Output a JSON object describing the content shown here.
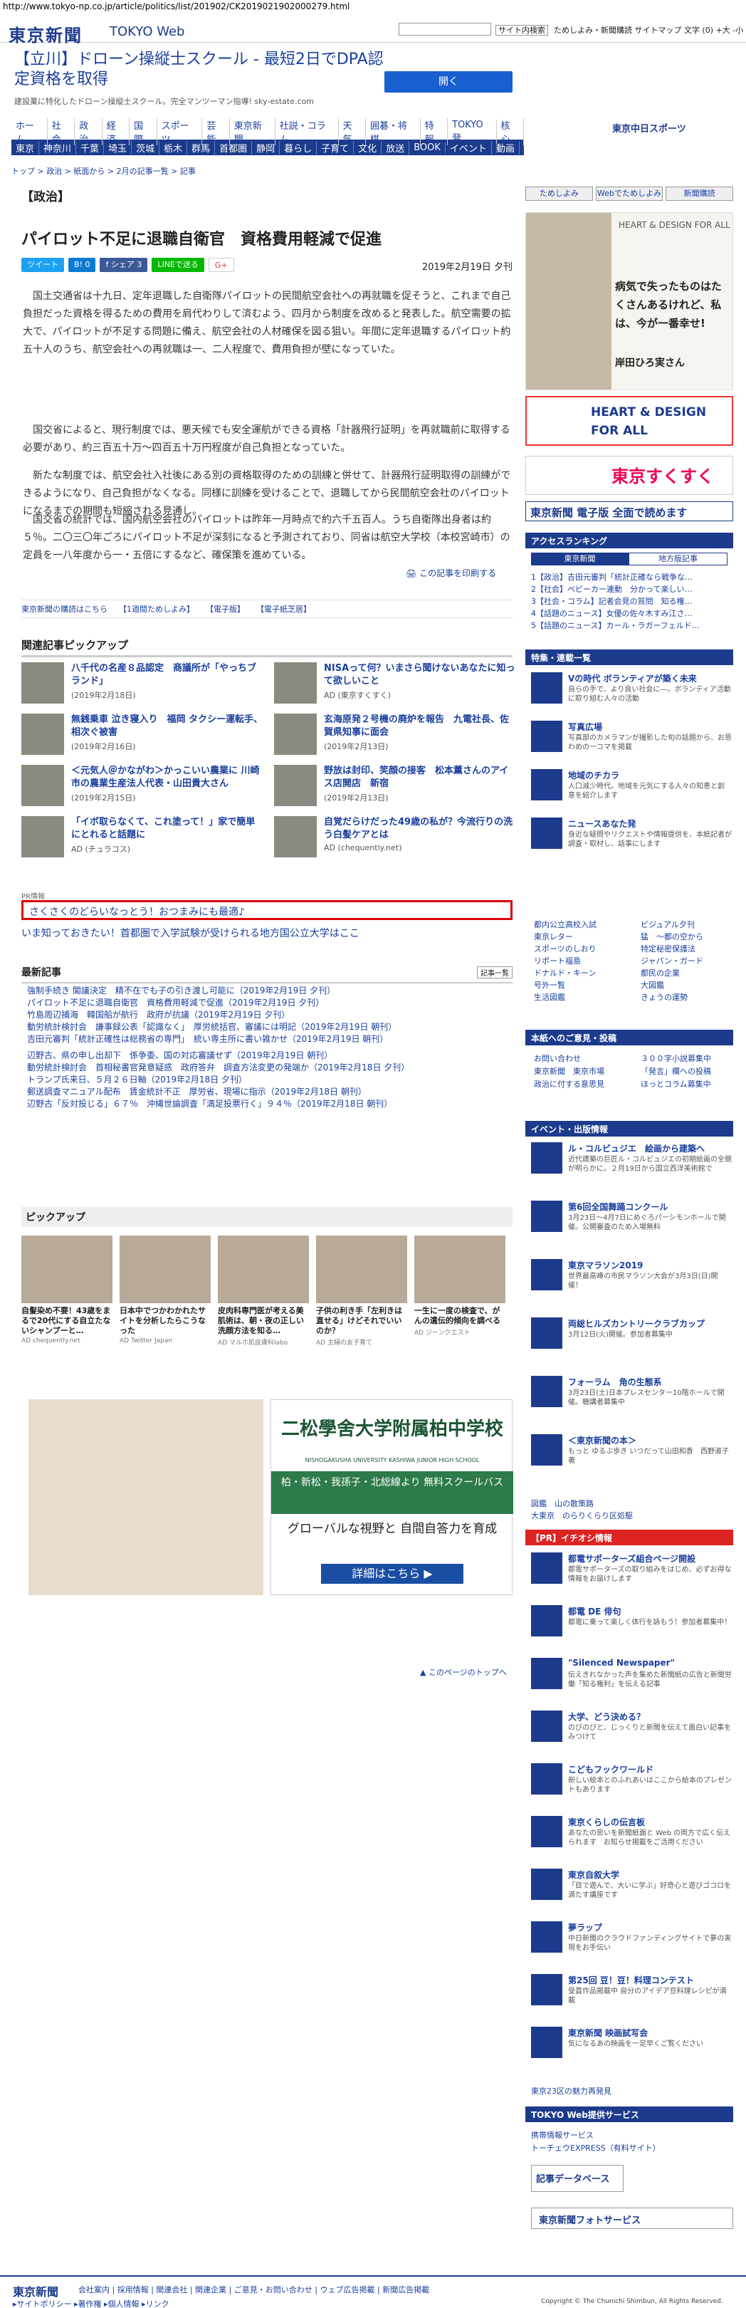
{
  "url": "http://www.tokyo-np.co.jp/article/politics/list/201902/CK2019021902000279.html",
  "header": {
    "logo": "東京新聞",
    "web": "TOKYO Web",
    "search_btn": "サイト内検索",
    "links": "ためしよみ・新聞購読  サイトマップ  文字 (0) +大 -小"
  },
  "ad": {
    "title": "【立川】ドローン操縦士スクール - 最短2日でDPA認定資格を取得",
    "sub": "建設業に特化したドローン操縦士スクール。完全マンツーマン指導! sky-estate.com",
    "button": "開く"
  },
  "nav": {
    "row1": [
      "ホーム",
      "社会",
      "政治",
      "経済",
      "国際",
      "スポーツ",
      "芸能",
      "東京新聞",
      "社説・コラム",
      "天気",
      "囲碁・将棋",
      "特報",
      "TOKYO発",
      "核心"
    ],
    "row2": [
      "東京",
      "神奈川",
      "千葉",
      "埼玉",
      "茨城",
      "栃木",
      "群馬",
      "首都圏",
      "静岡",
      "暮らし",
      "子育て",
      "文化",
      "放送",
      "BOOK",
      "イベント",
      "動画"
    ],
    "sports": "東京中日スポーツ"
  },
  "breadcrumb": "トップ > 政治 > 紙面から > 2月の記事一覧 > 記事",
  "article": {
    "genre": "【政治】",
    "title": "パイロット不足に退職自衛官　資格費用軽減で促進",
    "date": "2019年2月19日 夕刊",
    "share": [
      "ツイート",
      "B! 0",
      "f シェア 3",
      "LINEで送る",
      "G+"
    ],
    "paras": [
      "国土交通省は十九日、定年退職した自衛隊パイロットの民間航空会社への再就職を促そうと、これまで自己負担だった資格を得るための費用を肩代わりして済むよう、四月から制度を改めると発表した。航空需要の拡大で、パイロットが不足する問題に備え、航空会社の人材確保を図る狙い。年間に定年退職するパイロット約五十人のうち、航空会社への再就職は一、二人程度で、費用負担が壁になっていた。",
      "国交省によると、現行制度では、悪天候でも安全運航ができる資格「計器飛行証明」を再就職前に取得する必要があり、約三百五十万〜四百五十万円程度が自己負担となっていた。",
      "新たな制度では、航空会社入社後にある別の資格取得のための訓練と併せて、計器飛行証明取得の訓練ができるようになり、自己負担がなくなる。同様に訓練を受けることで、退職してから民間航空会社のパイロットになるまでの期間も短縮される見通し。",
      "国交省の統計では、国内航空会社のパイロットは昨年一月時点で約六千五百人。うち自衛隊出身者は約５％。二〇三〇年ごろにパイロット不足が深刻になると予測されており、同省は航空大学校（本校宮崎市）の定員を一八年度から一・五倍にするなど、確保策を進めている。"
    ],
    "print": "この記事を印刷する",
    "footer_links": [
      "東京新聞の購読はこちら",
      "【1週間ためしよみ】",
      "【電子版】",
      "【電子紙芝居】"
    ]
  },
  "related": {
    "heading": "関連記事ピックアップ",
    "items": [
      {
        "t": "八千代の名産８品認定　商議所が「やっちブランド」",
        "d": "(2019年2月18日)"
      },
      {
        "t": "NISAって何？いまさら聞けないあなたに知って欲しいこと",
        "d": "AD (東京すくすく)"
      },
      {
        "t": "無銭乗車 泣き寝入り　福岡 タクシー運転手、相次ぐ被害",
        "d": "(2019年2月16日)"
      },
      {
        "t": "玄海原発２号機の廃炉を報告　九電社長、佐賀県知事に面会",
        "d": "(2019年2月13日)"
      },
      {
        "t": "＜元気人＠かながわ＞かっこいい農業に 川崎市の農業生産法人代表・山田貴大さん",
        "d": "(2019年2月15日)"
      },
      {
        "t": "野放は封印、笑顔の接客　松本薫さんのアイス店開店　新宿",
        "d": "(2019年2月13日)"
      },
      {
        "t": "「イボ取らなくて、これ塗って！」家で簡単にとれると話題に",
        "d": "AD (チュラコス)"
      },
      {
        "t": "自覚だらけだった49歳の私が？今流行りの洗う白髪ケアとは",
        "d": "AD (chequently.net)"
      }
    ]
  },
  "pr": {
    "label": "PR情報",
    "box": "さくさくのどらいなっとう！おつまみにも最適♪",
    "line": "いま知っておきたい！首都圏で入学試験が受けられる地方国公立大学はここ"
  },
  "latest": {
    "heading": "最新記事",
    "ichiran": "記事一覧",
    "items": [
      "強制手続き 閣議決定　精不在でも子の引き渡し可能に（2019年2月19日 夕刊）",
      "パイロット不足に退職自衛官　資格費用軽減で促進（2019年2月19日 夕刊）",
      "竹島周辺捕海　韓国船が航行　政府が抗議（2019年2月19日 夕刊）",
      "動労統計検討会　謙事録公表「認識なく」　厚労統括官、審議には明記（2019年2月19日 朝刊）",
      "吉田元審判「統計正確性は総務省の専門」　統い専主所に書い雑かせ（2019年2月19日 朝刊）",
      "辺野古、県の申し出却下　係争委、国の対応審議せず（2019年2月19日 朝刊）",
      "動労統計検討会　首相秘書官発意疑惑　政府答弁　調査方法変更の発端か（2019年2月18日 夕刊）",
      "トランプ氏来日、５月２６日軸（2019年2月18日 夕刊）",
      "郵送調査マニュアル配布　賃金統計不正　厚労省、現場に指示（2019年2月18日 朝刊）",
      "辺野古「反対投じる」６７％　沖縄世論調査「満足投票行く」９４％（2019年2月18日 朝刊）"
    ]
  },
  "pickup": {
    "heading": "ピックアップ",
    "items": [
      {
        "t": "自髪染め不要！43歳をまるで20代にする自立たないシャンプーと…",
        "s": "AD chequently.net"
      },
      {
        "t": "日本中でつかわかれたサイトを分析したらこうなった",
        "s": "AD Twitter Japan"
      },
      {
        "t": "皮肉科専門医が考える美肌術は、朝・夜の正しい洗顔方法を知る…",
        "s": "AD マルホ肌皮膚科labo"
      },
      {
        "t": "子供の利き手「左利きは直せる」けどそれでいいのか？",
        "s": "AD 主婦の友子育て"
      },
      {
        "t": "一生に一度の検査で、がんの遺伝的傾向を調べる",
        "s": "AD ジーンクエスト"
      }
    ]
  },
  "bigad": {
    "school": "二松學舍大学附属柏中学校",
    "en": "NISHOGAKUSHA UNIVERSITY KASHIWA JUNIOR HIGH SCHOOL",
    "band": "柏・新松・我孫子・北総線より 無料スクールバス",
    "copy": "グローバルな視野と 自間自答力を育成",
    "btn": "詳細はこちら ▶"
  },
  "totop": "▲ このページのトップへ",
  "sidebar": {
    "top_btns": [
      "ためしよみ",
      "Webでためしよみ",
      "新聞購読"
    ],
    "heart": {
      "logo": "HEART & DESIGN FOR ALL",
      "text": "病気で失ったものはたくさんあるけれど、私は、今が一番幸せ!",
      "name": "岸田ひろ実さん"
    },
    "heart2": "HEART & DESIGN FOR ALL",
    "kodomo": "東京すくすく",
    "shimbun": "東京新聞 電子版 全面で読めます",
    "access": "アクセスランキング",
    "access_tabs": [
      "東京新聞",
      "地方版記事"
    ],
    "access_items": [
      "1【政治】吉田元審判「統計正確なら戦争な…",
      "2【社会】ベビーカー連動　分かって楽しい…",
      "3【社会・コラム】記者会見の質問　知る権…",
      "4【話題のニュース】女優の佐々木すみ江さ…",
      "5【話題のニュース】カール・ラガーフェルド…"
    ],
    "special": "特集・連載一覧",
    "features": [
      {
        "t": "Vの時代 ボランティアが築く未来",
        "d": "自らの手で、より良い社会に―。ボランティア活動に取り組む人々の活動"
      },
      {
        "t": "写真広場",
        "d": "写真部のカメラマンが撮影した旬の話題から、お思わめの一コマを掲載"
      },
      {
        "t": "地域のチカラ",
        "d": "人口減少時代。地域を元気にする人々の知恵と創意を紹介します"
      },
      {
        "t": "ニュースあなた発",
        "d": "身近な疑問やリクエストや情報提供を、本紙記者が調査・取材し、話事にします"
      }
    ],
    "cat": [
      "都内公立高校入試",
      "東京レター",
      "スポーツのしおり",
      "リポート福島",
      "ドナルド・キーン",
      "号外一覧",
      "生活図鑑",
      "ビジュアル夕刊",
      "猛　〜都の空から",
      "特定秘密保護法",
      "ジャパン・ガード",
      "都民の企業",
      "大図鑑",
      "きょうの運勢"
    ],
    "voice": "本紙へのご意見・投稿",
    "voice_items": [
      "お問い合わせ",
      "東京新聞　東京市場",
      "政治に付する意思見",
      "３００字小説募集中",
      "「発言」欄への投稿",
      "ほっとコラム募集中"
    ],
    "event": "イベント・出版情報",
    "events": [
      {
        "t": "ル・コルビュジエ　絵画から建築へ",
        "d": "近代建築の巨匠ル・コルビュジエの初期絵画の全貌が明らかに。２月19日から国立西洋美術館で"
      },
      {
        "t": "第6回全国舞踊コンクール",
        "d": "3月23日〜4月7日にめぐろパーシモンホールで開催。公開審査のため入場無料"
      },
      {
        "t": "東京マラソン2019",
        "d": "世界最高峰の市民マラソン大会が3月3日(日)開催！"
      },
      {
        "t": "両総ヒルズカントリークラブカップ",
        "d": "3月12日(火)開催。参加者募集中"
      },
      {
        "t": "フォーラム　角の生態系",
        "d": "3月23日(土)日本プレスセンター10階ホールで開催。聴講者募集中"
      },
      {
        "t": "＜東京新聞の本＞",
        "d": "もっと ゆるぶ歩き いつだって山田和香　西野淑子 著"
      }
    ],
    "free": [
      "図鑑　山の散策路",
      "大東京　のらりくらり区処駆"
    ],
    "pr": "【PR】イチオシ情報",
    "prs": [
      {
        "t": "都電サポーターズ組合ページ開設",
        "d": "都電サポーターズの取り組みをはじめ、必ずお得な情報をお届けします"
      },
      {
        "t": "都電 DE 俳句",
        "d": "都電に乗って楽しく体行を詠もう！参加者募集中！"
      },
      {
        "t": "\"Silenced Newspaper\"",
        "d": "伝えきれなかった声を集めた新聞紙の広告と新聞労働「知る権利」を伝える記事"
      },
      {
        "t": "大学、どう決める？",
        "d": "のびのびと、じっくりと新聞を伝えて面白い記事をみつけて"
      },
      {
        "t": "こどもフックワールド",
        "d": "新しい絵本とのふれあいはここから絵本のプレゼントもあります"
      },
      {
        "t": "東京くらしの伝言板",
        "d": "あなたの思いを新聞紙面と Web の両方で広く伝えられます　お知らせ掲載をご活用ください"
      },
      {
        "t": "東京自叙大学",
        "d": "「目で遊んで、大いに学ぶ」好奇心と遊びゴコロを満たす講座です"
      },
      {
        "t": "夢ラップ",
        "d": "中日新聞のクラウドファンディングサイトで夢の実現をお手伝い"
      },
      {
        "t": "第25回 豆！豆！料理コンテスト",
        "d": "受賞作品掲載中 自分のアイデア豆料理レシピが満載"
      },
      {
        "t": "東京新聞 映画試写会",
        "d": "気になるあの映画を一足早くご覧ください"
      }
    ],
    "kodomo_link": "東京23区の魅力再発見",
    "service": "TOKYO Web提供サービス",
    "services": [
      "携帯情報サービス",
      "トーチェウEXPRESS（有料サイト）"
    ],
    "db": "記事データベース",
    "photo": "東京新聞フォトサービス"
  },
  "footer": {
    "logo": "東京新聞",
    "links": "会社案内 | 採用情報 | 関連会社 | 関連企業 | ご意見・お問い合わせ | ウェブ広告掲載 | 新聞広告掲載",
    "links2": "▸サイトポリシー ▸著作権 ▸個人情報 ▸リンク",
    "copy": "Copyright © The Chunichi Shimbun, All Rights Reserved."
  }
}
